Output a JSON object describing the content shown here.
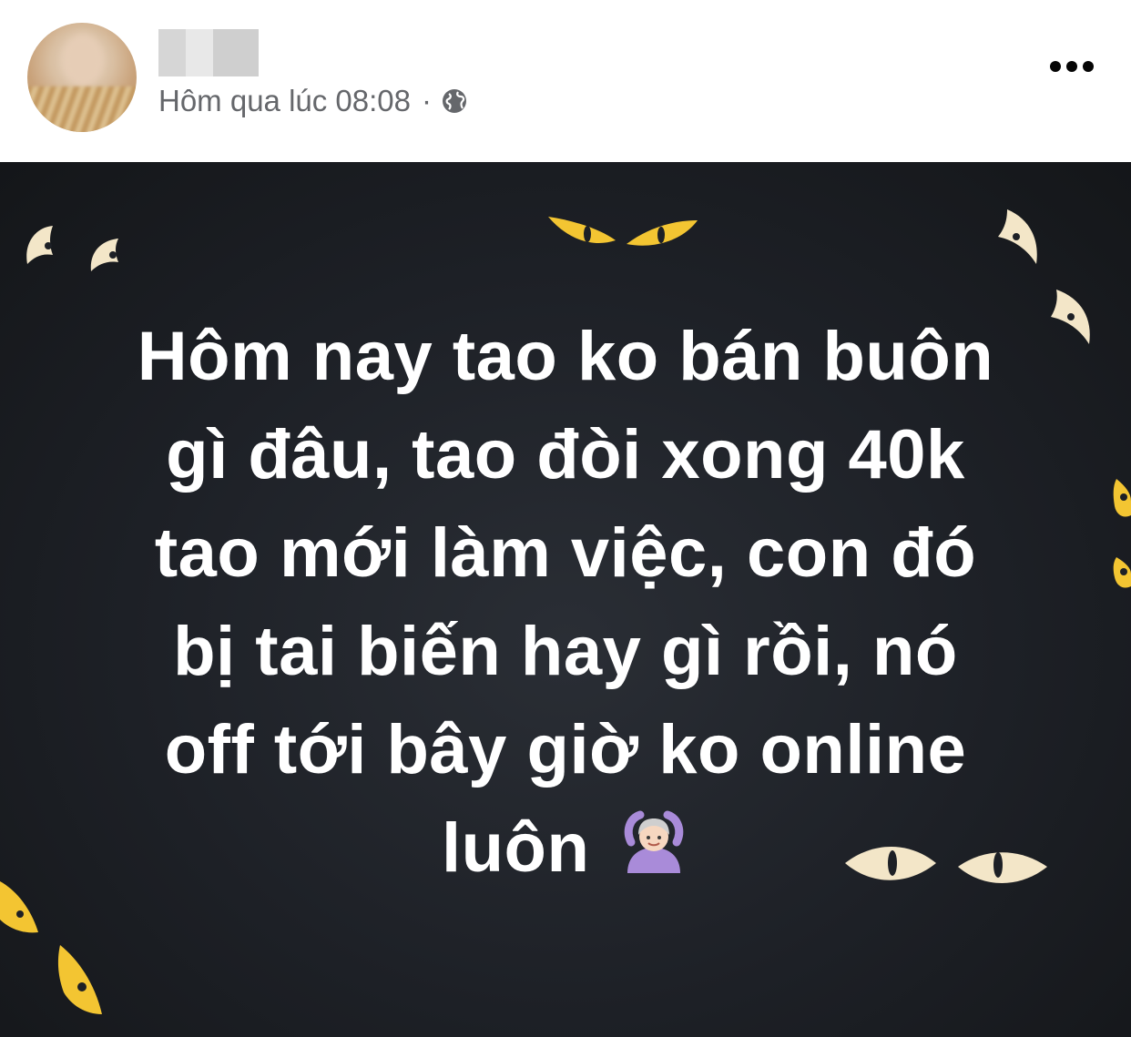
{
  "header": {
    "timestamp": "Hôm qua lúc 08:08",
    "separator": "·",
    "privacy_icon": "globe-icon",
    "menu_icon": "more-options-icon"
  },
  "post": {
    "text": "Hôm nay tao ko bán buôn\ngì đâu, tao đòi xong 40k\ntao mới làm việc, con đó\nbị tai biến hay gì rồi, nó\noff tới bây giờ ko online\nluôn",
    "emoji": "person-gesturing-ok-icon",
    "background_colors": [
      "#1d2026",
      "#141619"
    ],
    "decoration_color_cream": "#f3e6c8",
    "decoration_color_yellow": "#f3c532"
  }
}
